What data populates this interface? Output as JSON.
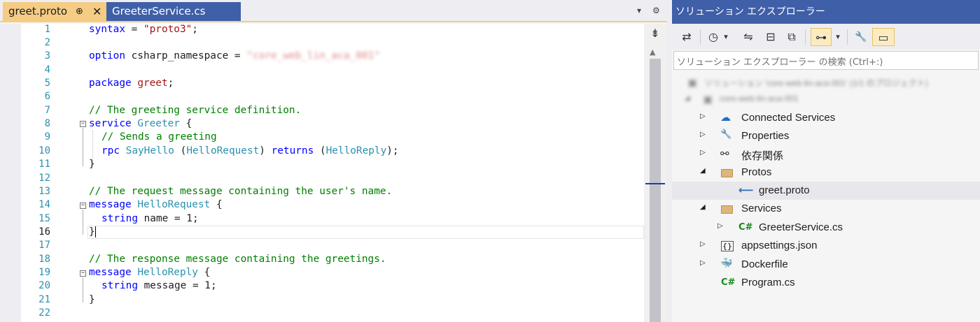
{
  "editor": {
    "tabs": [
      {
        "label": "greet.proto",
        "pin": "⊕",
        "close": "✕"
      },
      {
        "label": "GreeterService.cs"
      }
    ],
    "tab_controls": {
      "dropdown": "▾",
      "settings": "⚙"
    },
    "lines": [
      {
        "n": "1"
      },
      {
        "n": "2"
      },
      {
        "n": "3"
      },
      {
        "n": "4"
      },
      {
        "n": "5"
      },
      {
        "n": "6"
      },
      {
        "n": "7"
      },
      {
        "n": "8"
      },
      {
        "n": "9"
      },
      {
        "n": "10"
      },
      {
        "n": "11"
      },
      {
        "n": "12"
      },
      {
        "n": "13"
      },
      {
        "n": "14"
      },
      {
        "n": "15"
      },
      {
        "n": "16"
      },
      {
        "n": "17"
      },
      {
        "n": "18"
      },
      {
        "n": "19"
      },
      {
        "n": "20"
      },
      {
        "n": "21"
      },
      {
        "n": "22"
      }
    ],
    "code": {
      "l1": {
        "kw": "syntax",
        "eq": " = ",
        "str": "\"proto3\"",
        "end": ";"
      },
      "l3": {
        "kw": "option",
        "id": " csharp_namespace = ",
        "redacted": "\"core_web_lin_aca_001\""
      },
      "l5": {
        "kw": "package",
        "id": " greet",
        "end": ";"
      },
      "l7": {
        "comment": "// The greeting service definition."
      },
      "l8": {
        "kw": "service",
        "type": " Greeter",
        "end": " {"
      },
      "l9": {
        "comment": "// Sends a greeting"
      },
      "l10": {
        "kw": "rpc",
        "type": " SayHello",
        "p1": " (",
        "arg": "HelloRequest",
        "p2": ") ",
        "kw2": "returns",
        "p3": " (",
        "ret": "HelloReply",
        "p4": ");"
      },
      "l11": {
        "text": "}"
      },
      "l13": {
        "comment": "// The request message containing the user's name."
      },
      "l14": {
        "kw": "message",
        "type": " HelloRequest",
        "end": " {"
      },
      "l15": {
        "kw": "string",
        "id": " name = 1;"
      },
      "l16": {
        "text": "}"
      },
      "l18": {
        "comment": "// The response message containing the greetings."
      },
      "l19": {
        "kw": "message",
        "type": " HelloReply",
        "end": " {"
      },
      "l20": {
        "kw": "string",
        "id": " message = 1;"
      },
      "l21": {
        "text": "}"
      }
    },
    "fold_glyph": "−",
    "split_glyph": "⇟",
    "scroll_up_glyph": "▲"
  },
  "solution_explorer": {
    "title": "ソリューション エクスプローラー",
    "toolbar": [
      {
        "icon": "vs-switch-icon",
        "glyph": "⇄"
      },
      {
        "icon": "history-icon",
        "glyph": "◷"
      },
      {
        "icon": "dropdown-icon",
        "glyph": "▾"
      },
      {
        "icon": "sync-icon",
        "glyph": "⇋"
      },
      {
        "icon": "collapse-all-icon",
        "glyph": "⊟"
      },
      {
        "icon": "show-all-files-icon",
        "glyph": "⧉"
      },
      {
        "icon": "tree-view-icon",
        "glyph": "⊶"
      },
      {
        "icon": "dropdown-icon",
        "glyph": "▾"
      },
      {
        "icon": "properties-wrench-icon",
        "glyph": "🔧"
      },
      {
        "icon": "preview-icon",
        "glyph": "▭"
      }
    ],
    "search_placeholder": "ソリューション エクスプローラー の検索 (Ctrl+:)",
    "tree": [
      {
        "label": "ソリューション 'core-web-lin-aca-001' (1/1 のプロジェクト)",
        "redacted": true,
        "indent": 0,
        "expander": "",
        "icon": "solution-icon"
      },
      {
        "label": "core-web-lin-aca-001",
        "redacted": true,
        "indent": 1,
        "expander": "◢",
        "icon": "project-icon"
      },
      {
        "label": "Connected Services",
        "indent": 2,
        "expander": "▷",
        "icon": "connected-services-icon",
        "glyph": "☁"
      },
      {
        "label": "Properties",
        "indent": 2,
        "expander": "▷",
        "icon": "properties-icon",
        "glyph": "🔧"
      },
      {
        "label": "依存関係",
        "indent": 2,
        "expander": "▷",
        "icon": "dependencies-icon",
        "glyph": "⚯"
      },
      {
        "label": "Protos",
        "indent": 2,
        "expander": "◢",
        "icon": "folder-icon"
      },
      {
        "label": "greet.proto",
        "indent": 3,
        "expander": "",
        "icon": "proto-file-icon",
        "glyph": "⟵",
        "selected": true
      },
      {
        "label": "Services",
        "indent": 2,
        "expander": "◢",
        "icon": "folder-icon"
      },
      {
        "label": "GreeterService.cs",
        "indent": 3,
        "expander": "▷",
        "icon": "csharp-file-icon",
        "glyph": "C#"
      },
      {
        "label": "appsettings.json",
        "indent": 2,
        "expander": "▷",
        "icon": "json-file-icon",
        "glyph": "{}"
      },
      {
        "label": "Dockerfile",
        "indent": 2,
        "expander": "▷",
        "icon": "docker-icon",
        "glyph": "🐳"
      },
      {
        "label": "Program.cs",
        "indent": 2,
        "expander": "",
        "icon": "csharp-file-icon",
        "glyph": "C#"
      }
    ]
  },
  "colors": {
    "active_tab": "#f5cc84",
    "inactive_tab": "#3f5fa8",
    "keyword": "#0000ff",
    "type": "#2b91af",
    "string": "#a31515",
    "comment": "#008000"
  }
}
